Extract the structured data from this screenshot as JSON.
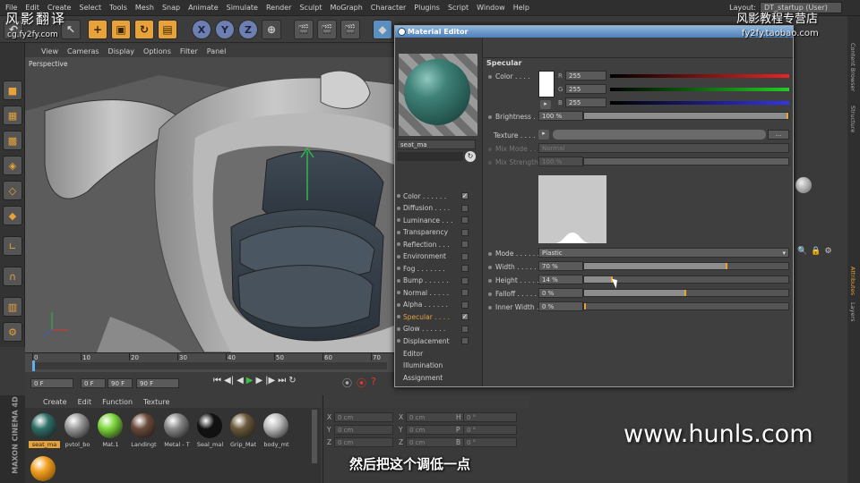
{
  "menubar": {
    "items": [
      "File",
      "Edit",
      "Create",
      "Select",
      "Tools",
      "Mesh",
      "Snap",
      "Animate",
      "Simulate",
      "Render",
      "Sculpt",
      "MoGraph",
      "Character",
      "Plugins",
      "Script",
      "Window",
      "Help"
    ],
    "layout_label": "Layout:",
    "layout_value": "DT_startup (User)"
  },
  "watermarks": {
    "top_left_cn": "风影翻译",
    "top_left_url": "cg.fy2fy.com",
    "top_right_cn": "风影教程专营店",
    "top_right_url": "fy2fy.taobao.com",
    "bottom_right": "www.hunls.com",
    "subtitle": "然后把这个调低一点",
    "maxon_logo": "MAXON CINEMA 4D"
  },
  "toolbar": {
    "axis_x": "X",
    "axis_y": "Y",
    "axis_z": "Z"
  },
  "viewport": {
    "menu": [
      "View",
      "Cameras",
      "Display",
      "Options",
      "Filter",
      "Panel"
    ],
    "label": "Perspective"
  },
  "timeline": {
    "ticks": [
      "0",
      "10",
      "20",
      "30",
      "40",
      "50",
      "60",
      "70"
    ],
    "start_field": "0 F",
    "range_field": "0 F",
    "range_end": "90 F",
    "end_field": "90 F"
  },
  "material_manager": {
    "menu": [
      "Create",
      "Edit",
      "Function",
      "Texture"
    ],
    "materials": [
      {
        "name": "seat_ma",
        "color": "#2f6f67",
        "selected": true
      },
      {
        "name": "pvtol_bo",
        "color": "#9a9a9a"
      },
      {
        "name": "Mat.1",
        "color": "#7cd63a"
      },
      {
        "name": "Landingt",
        "color": "#6a4a3a"
      },
      {
        "name": "Metal - T",
        "color": "#888888"
      },
      {
        "name": "Seal_mal",
        "color": "#111111"
      },
      {
        "name": "Grip_Mat",
        "color": "#6b5a3a"
      },
      {
        "name": "body_mt",
        "color": "#bcbcbc"
      }
    ]
  },
  "coords": {
    "rows": [
      {
        "a": "X",
        "av": "0 cm",
        "b": "X",
        "bv": "0 cm",
        "c": "H",
        "cv": "0 °"
      },
      {
        "a": "Y",
        "av": "0 cm",
        "b": "Y",
        "bv": "0 cm",
        "c": "P",
        "cv": "0 °"
      },
      {
        "a": "Z",
        "av": "0 cm",
        "b": "Z",
        "bv": "0 cm",
        "c": "B",
        "cv": "0 °"
      }
    ]
  },
  "right_tabs": [
    "Content Browser",
    "Structure",
    "Attributes",
    "Layers"
  ],
  "editor": {
    "title": "Material Editor",
    "material_name": "seat_ma",
    "channels": [
      {
        "label": "Color . . . . . .",
        "checked": true,
        "active": false
      },
      {
        "label": "Diffusion . . . .",
        "checked": false,
        "active": false
      },
      {
        "label": "Luminance . . .",
        "checked": false,
        "active": false
      },
      {
        "label": "Transparency",
        "checked": false,
        "active": false
      },
      {
        "label": "Reflection . . .",
        "checked": false,
        "active": false
      },
      {
        "label": "Environment",
        "checked": false,
        "active": false
      },
      {
        "label": "Fog . . . . . . .",
        "checked": false,
        "active": false
      },
      {
        "label": "Bump . . . . . .",
        "checked": false,
        "active": false
      },
      {
        "label": "Normal . . . . .",
        "checked": false,
        "active": false
      },
      {
        "label": "Alpha . . . . . .",
        "checked": false,
        "active": false
      },
      {
        "label": "Specular . . . .",
        "checked": true,
        "active": true
      },
      {
        "label": "Glow . . . . . .",
        "checked": false,
        "active": false
      },
      {
        "label": "Displacement",
        "checked": false,
        "active": false
      }
    ],
    "extras": [
      "Editor",
      "Illumination",
      "Assignment"
    ],
    "section": "Specular",
    "color_label": "Color . . . .",
    "r_label": "R",
    "r_value": "255",
    "g_label": "G",
    "g_value": "255",
    "b_label": "B",
    "b_value": "255",
    "brightness_label": "Brightness . .",
    "brightness_value": "100 %",
    "texture_label": "Texture . . . .",
    "mixmode_label": "Mix Mode . .",
    "mixmode_value": "Normal",
    "mixstrength_label": "Mix Strength",
    "mixstrength_value": "100 %",
    "mode_label": "Mode . . . . . .",
    "mode_value": "Plastic",
    "width_label": "Width . . . . .",
    "width_value": "70 %",
    "width_frac": 0.7,
    "height_label": "Height . . . . .",
    "height_value": "14 %",
    "height_frac": 0.14,
    "falloff_label": "Falloff . . . . .",
    "falloff_value": "0 %",
    "falloff_frac": 0.5,
    "innerwidth_label": "Inner Width . .",
    "innerwidth_value": "0 %",
    "innerwidth_frac": 0.0
  },
  "colors": {
    "accent": "#e8a23a",
    "title_blue": "#4d7fb8",
    "material_teal": "#2f6f67"
  }
}
